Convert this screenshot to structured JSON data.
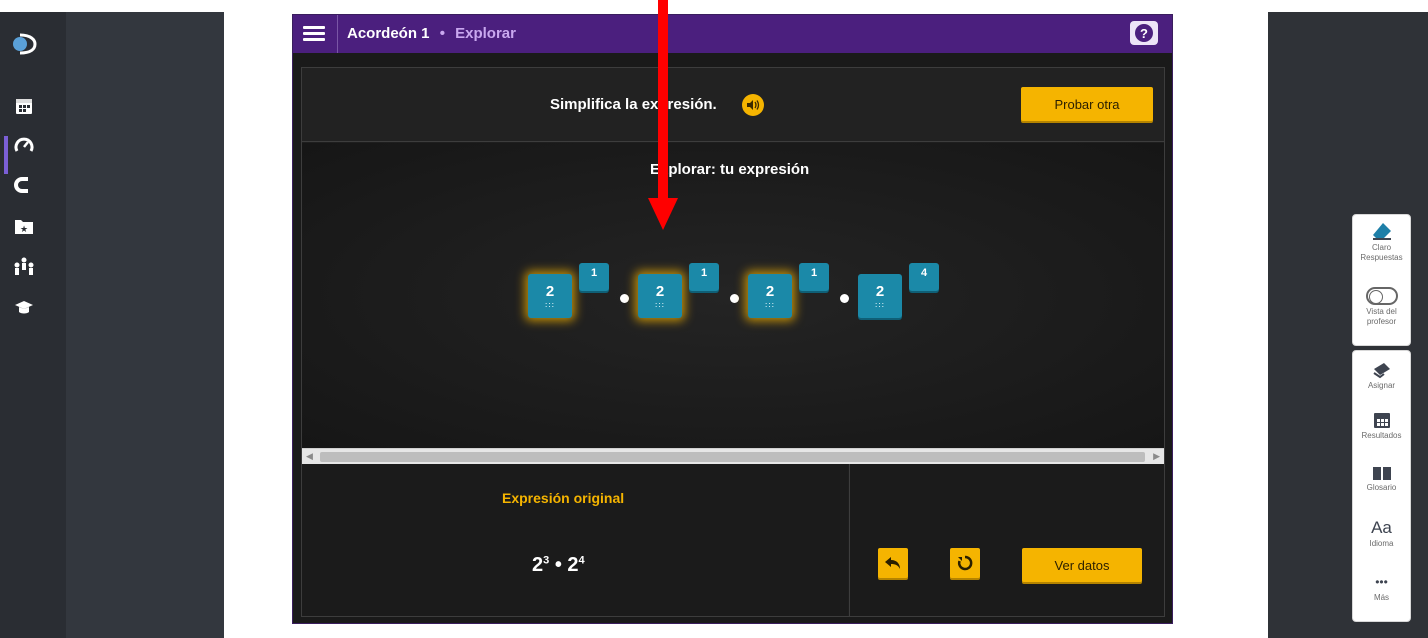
{
  "header": {
    "title": "Acordeón 1",
    "separator": "•",
    "subtitle": "Explorar",
    "help": "?"
  },
  "prompt": {
    "text": "Simplifica la expresión.",
    "audio_icon": "speaker-icon",
    "try_other_label": "Probar otra"
  },
  "explore": {
    "title": "Explorar: tu expresión",
    "terms": [
      {
        "base": "2",
        "exponent": "1"
      },
      {
        "base": "2",
        "exponent": "1"
      },
      {
        "base": "2",
        "exponent": "1"
      },
      {
        "base": "2",
        "exponent": "4"
      }
    ],
    "operator": "•"
  },
  "original": {
    "label": "Expresión original",
    "base1": "2",
    "exp1": "3",
    "operator": "•",
    "base2": "2",
    "exp2": "4"
  },
  "actions": {
    "undo_icon": "undo-icon",
    "reset_icon": "reset-icon",
    "view_data_label": "Ver datos"
  },
  "left_nav": {
    "items": [
      "globe-logo-icon",
      "calendar-icon",
      "gauge-icon",
      "magnet-icon",
      "star-folder-icon",
      "people-icon",
      "graduation-cap-icon"
    ]
  },
  "tools": {
    "clear_label_1": "Claro",
    "clear_label_2": "Respuestas",
    "teacher_view_label_1": "Vista del",
    "teacher_view_label_2": "profesor",
    "assign_label": "Asignar",
    "results_label": "Resultados",
    "glossary_label": "Glosario",
    "language_glyph": "Aa",
    "language_label": "Idioma",
    "more_glyph": "•••",
    "more_label": "Más"
  },
  "colors": {
    "header_purple": "#4b1f7e",
    "accent_yellow": "#f5b400",
    "tile_teal": "#1b89a8",
    "annotation_red": "#ff0000"
  }
}
